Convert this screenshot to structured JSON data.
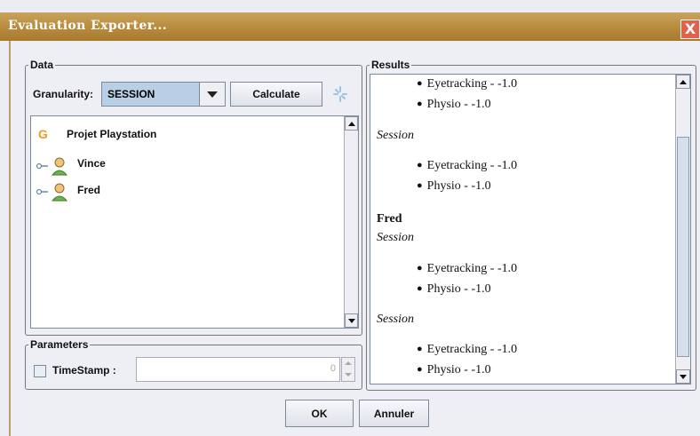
{
  "window": {
    "title": "Evaluation Exporter...",
    "close_symbol": "X"
  },
  "data_panel": {
    "legend": "Data",
    "granularity_label": "Granularity:",
    "granularity_value": "SESSION",
    "calculate_label": "Calculate",
    "tree": {
      "root": {
        "label": "Projet Playstation",
        "icon": "project-icon"
      },
      "children": [
        {
          "label": "Vince",
          "icon": "user-icon"
        },
        {
          "label": "Fred",
          "icon": "user-icon"
        }
      ]
    }
  },
  "parameters_panel": {
    "legend": "Parameters",
    "timestamp_label": "TimeStamp :",
    "timestamp_checked": false,
    "timestamp_value": "0"
  },
  "results_panel": {
    "legend": "Results",
    "lines": [
      {
        "type": "bullet",
        "text": "Eyetracking - -1.0"
      },
      {
        "type": "bullet",
        "text": "Physio - -1.0"
      },
      {
        "type": "session",
        "text": "Session"
      },
      {
        "type": "bullet",
        "text": "Eyetracking - -1.0"
      },
      {
        "type": "bullet",
        "text": "Physio - -1.0"
      },
      {
        "type": "user",
        "text": "Fred"
      },
      {
        "type": "session",
        "text": "Session"
      },
      {
        "type": "bullet",
        "text": "Eyetracking - -1.0"
      },
      {
        "type": "bullet",
        "text": "Physio - -1.0"
      },
      {
        "type": "session",
        "text": "Session"
      },
      {
        "type": "bullet",
        "text": "Eyetracking - -1.0"
      },
      {
        "type": "bullet",
        "text": "Physio - -1.0"
      }
    ]
  },
  "buttons": {
    "ok": "OK",
    "cancel": "Annuler"
  },
  "colors": {
    "title_bar": "#b88a3c",
    "selection": "#b8cfe5",
    "close": "#e3604a",
    "project_icon": "#f39a1e"
  }
}
